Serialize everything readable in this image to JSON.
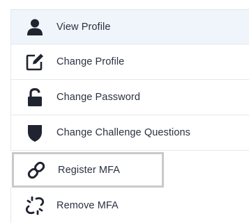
{
  "menu": {
    "items": [
      {
        "label": "View Profile",
        "icon": "user-icon"
      },
      {
        "label": "Change Profile",
        "icon": "edit-icon"
      },
      {
        "label": "Change Password",
        "icon": "unlock-icon"
      },
      {
        "label": "Change Challenge Questions",
        "icon": "shield-icon"
      },
      {
        "label": "Register MFA",
        "icon": "link-icon"
      },
      {
        "label": "Remove MFA",
        "icon": "broken-link-icon"
      }
    ]
  },
  "colors": {
    "text": "#2a3140",
    "icon": "#1f2430",
    "active_bg": "#eff5fa",
    "divider": "#e6e8ea",
    "focus_border": "#c9c9c9"
  }
}
